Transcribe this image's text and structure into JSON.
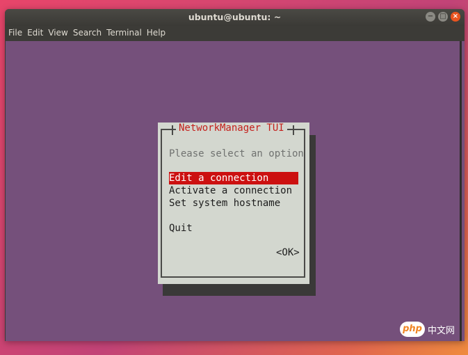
{
  "window": {
    "title": "ubuntu@ubuntu: ~",
    "controls": {
      "minimize_icon": "−",
      "maximize_icon": "□",
      "close_icon": "×"
    }
  },
  "menubar": [
    "File",
    "Edit",
    "View",
    "Search",
    "Terminal",
    "Help"
  ],
  "terminal": {
    "background_color": "#75507b"
  },
  "dialog": {
    "title": "NetworkManager TUI",
    "prompt": "Please select an option",
    "options": [
      {
        "label": "Edit a connection",
        "selected": true
      },
      {
        "label": "Activate a connection",
        "selected": false
      },
      {
        "label": "Set system hostname",
        "selected": false
      },
      {
        "label": "Quit",
        "selected": false
      }
    ],
    "ok_label": "<OK>",
    "selection_color": "#cc1010",
    "title_color": "#c4201c"
  },
  "watermark": {
    "logo_text": "php",
    "text": "中文网"
  }
}
